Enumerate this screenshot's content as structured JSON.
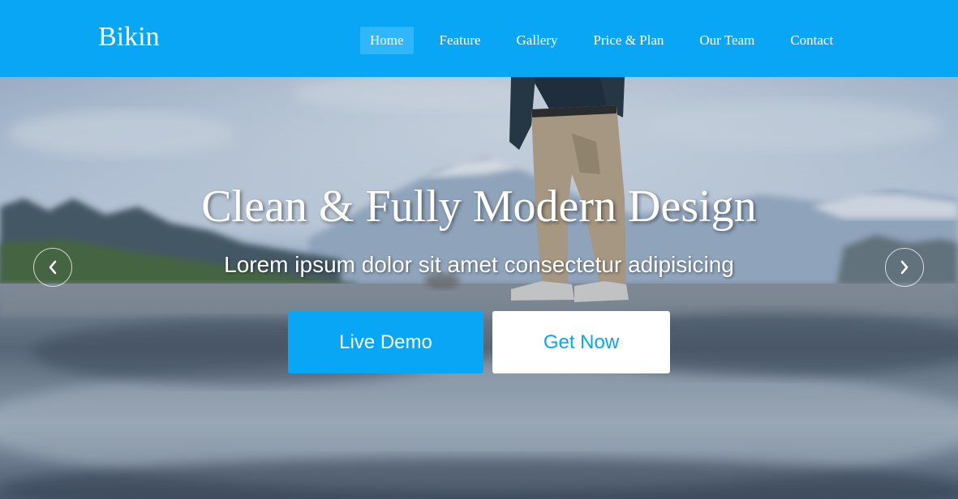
{
  "header": {
    "brand": "Bikin",
    "nav": [
      {
        "label": "Home",
        "active": true
      },
      {
        "label": "Feature",
        "active": false
      },
      {
        "label": "Gallery",
        "active": false
      },
      {
        "label": "Price & Plan",
        "active": false
      },
      {
        "label": "Our Team",
        "active": false
      },
      {
        "label": "Contact",
        "active": false
      }
    ]
  },
  "hero": {
    "title": "Clean & Fully Modern Design",
    "subtitle": "Lorem ipsum dolor sit amet consectetur adipisicing",
    "primary_button": "Live Demo",
    "secondary_button": "Get Now",
    "prev_icon": "chevron-left-icon",
    "next_icon": "chevron-right-icon"
  },
  "colors": {
    "accent": "#0aa6f6",
    "nav_active": "#2fb6fb",
    "text_light": "#ffffff"
  }
}
